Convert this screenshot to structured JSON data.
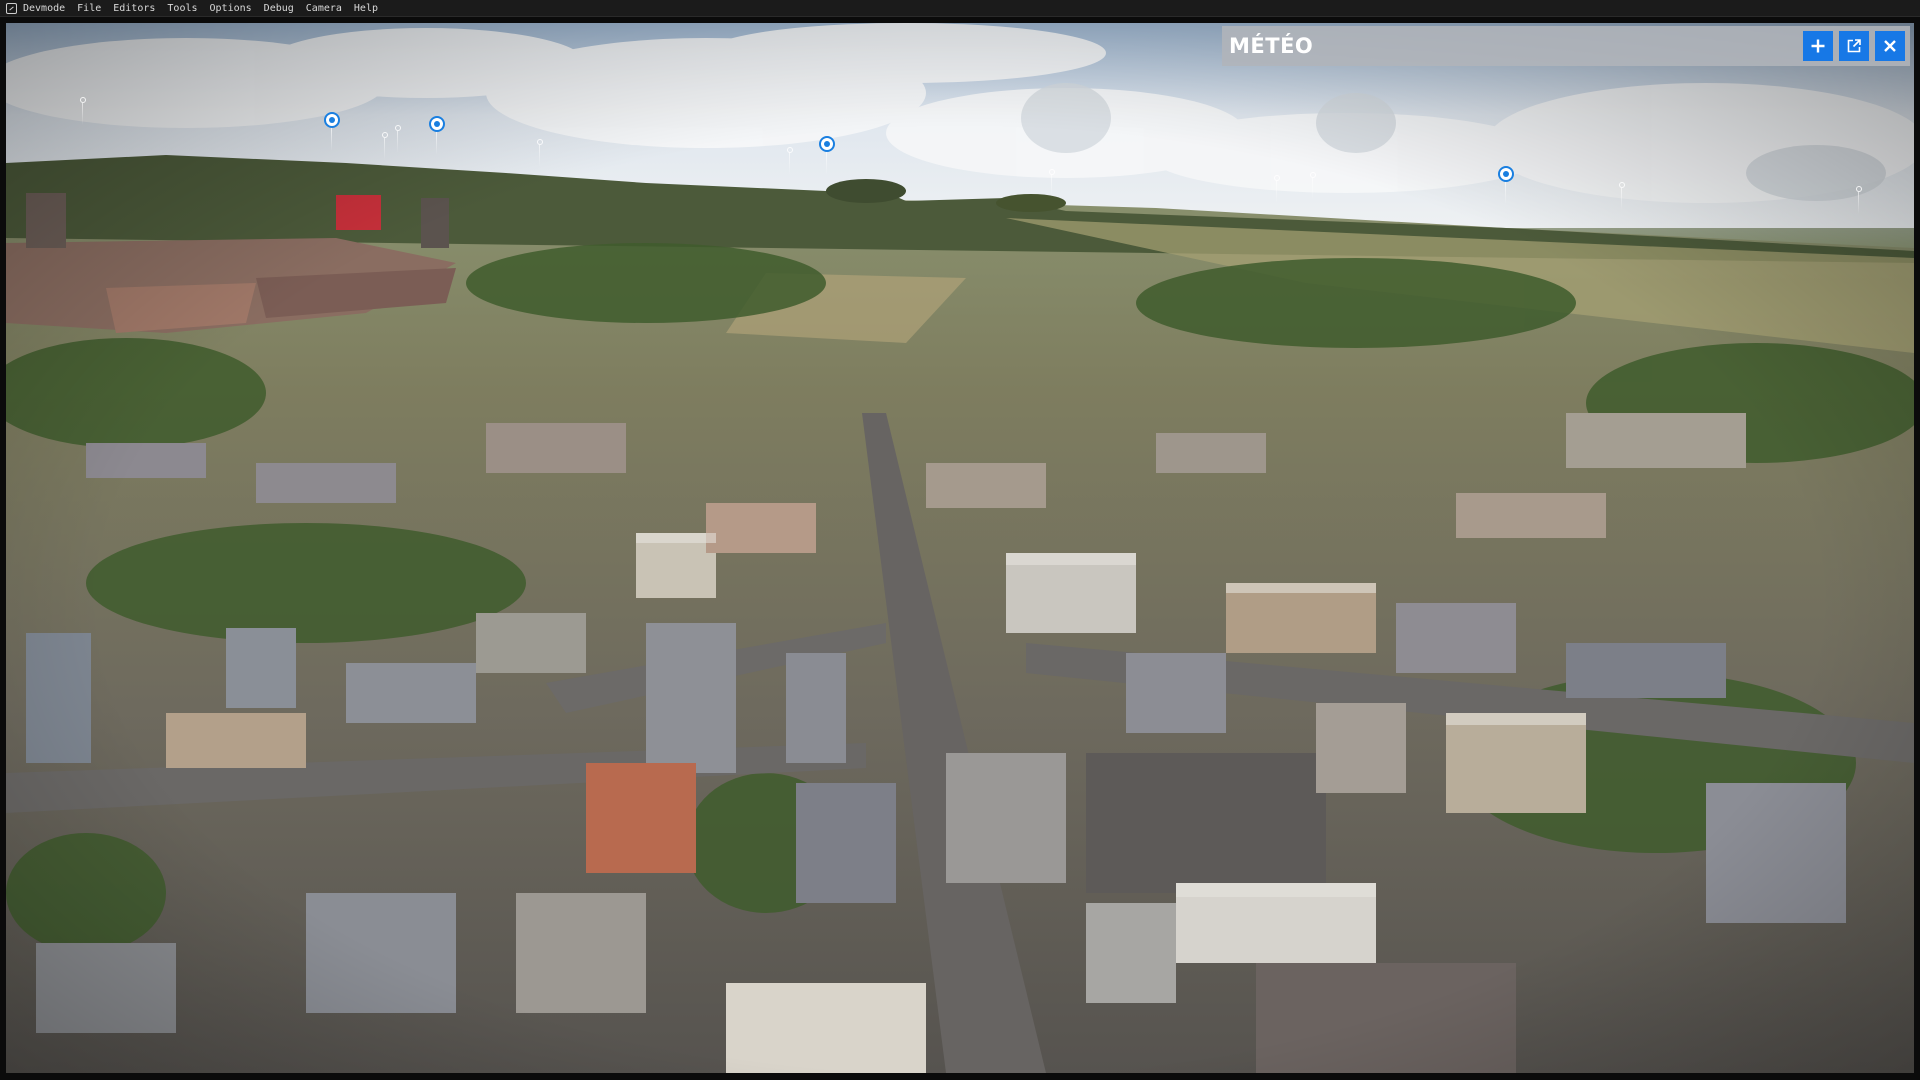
{
  "app": {
    "name": "Devmode",
    "icon": "devmode-logo-icon"
  },
  "menu": {
    "items": [
      "File",
      "Editors",
      "Tools",
      "Options",
      "Debug",
      "Camera",
      "Help"
    ]
  },
  "weather_panel": {
    "title": "MÉTÉO",
    "buttons": [
      {
        "name": "add",
        "icon": "plus-icon"
      },
      {
        "name": "undock",
        "icon": "external-window-icon"
      },
      {
        "name": "close",
        "icon": "close-icon"
      }
    ],
    "accent_color": "#1778e6"
  },
  "viewport": {
    "content": "aerial-photogrammetry-view",
    "placemark_icon": "location-pin-icon",
    "placemark_color": "#1a7fe0"
  }
}
